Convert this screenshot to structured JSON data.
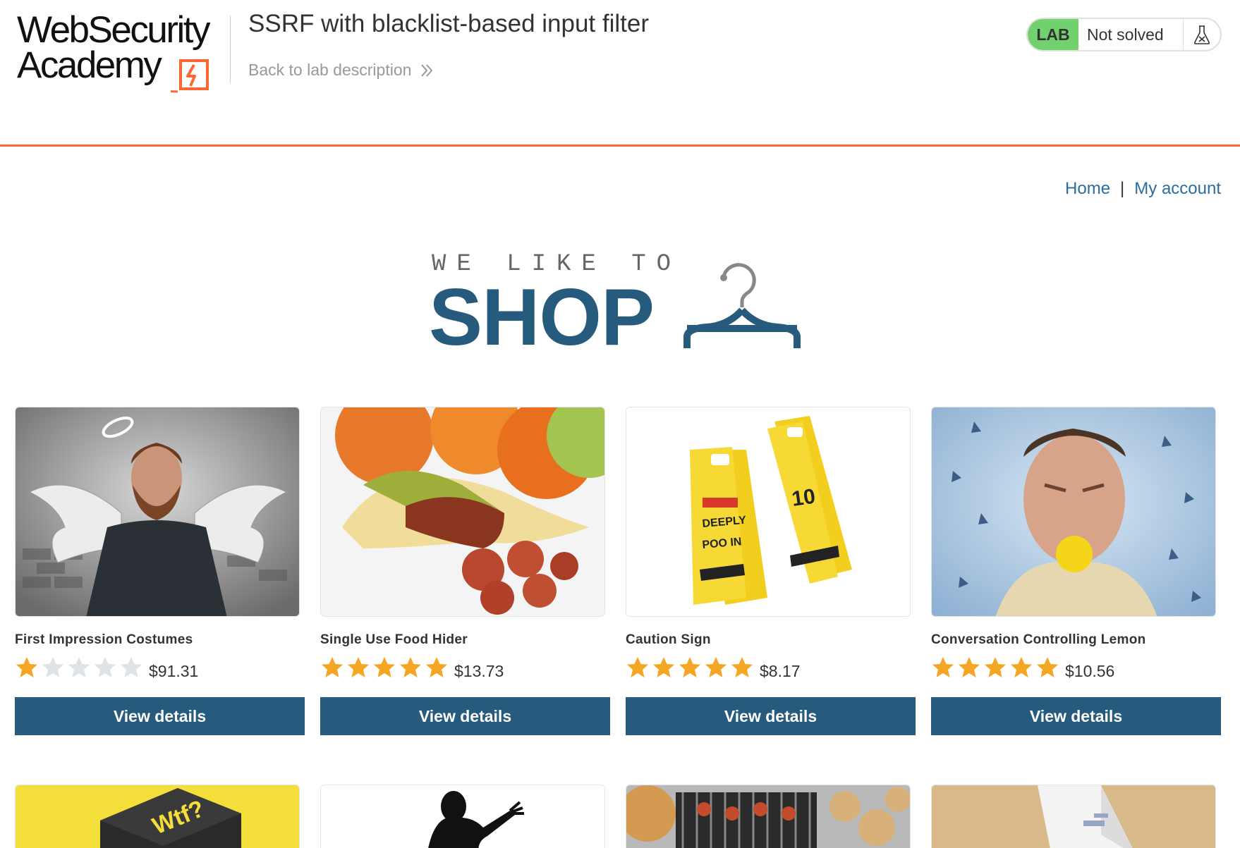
{
  "header": {
    "logo_line1": "WebSecurity",
    "logo_line2": "Academy",
    "lab_title": "SSRF with blacklist-based input filter",
    "back_link": "Back to lab description",
    "status_label": "LAB",
    "status_text": "Not solved",
    "colors": {
      "accent": "#ff6633",
      "solved_badge": "#70d16d"
    }
  },
  "nav": {
    "home": "Home",
    "separator": "|",
    "account": "My account"
  },
  "banner": {
    "top": "WE LIKE TO",
    "main": "SHOP"
  },
  "products": [
    {
      "name": "First Impression Costumes",
      "rating": 1,
      "price": "$91.31",
      "button": "View details"
    },
    {
      "name": "Single Use Food Hider",
      "rating": 5,
      "price": "$13.73",
      "button": "View details"
    },
    {
      "name": "Caution Sign",
      "rating": 5,
      "price": "$8.17",
      "button": "View details"
    },
    {
      "name": "Conversation Controlling Lemon",
      "rating": 5,
      "price": "$10.56",
      "button": "View details"
    }
  ],
  "colors": {
    "brand_blue": "#275b7e",
    "link_blue": "#2c6d9e",
    "star_on": "#f5a623",
    "star_off": "#dde3e6"
  }
}
